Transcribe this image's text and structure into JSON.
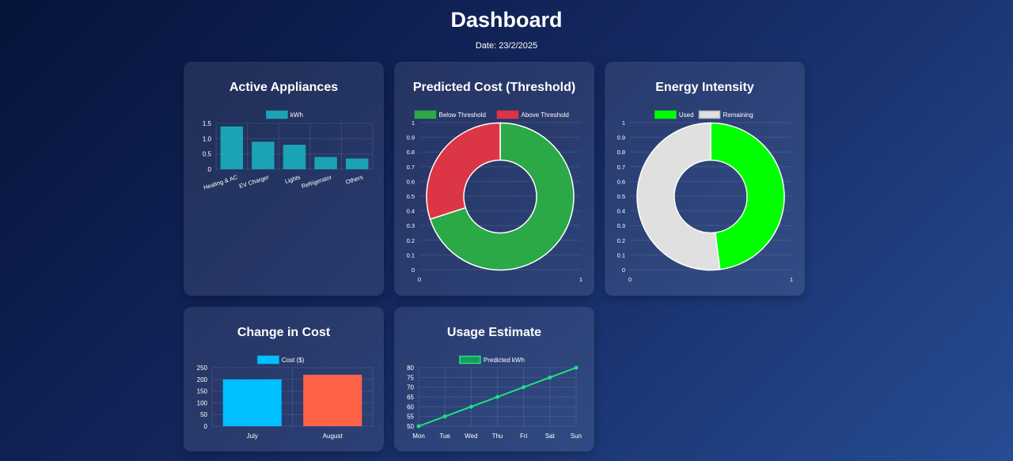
{
  "header": {
    "title": "Dashboard",
    "date": "Date: 23/2/2025"
  },
  "colors": {
    "appliances_bar": "#1aa3b5",
    "below_threshold": "#2aa946",
    "above_threshold": "#dc3545",
    "used": "#00ff00",
    "remaining": "#e0e0e0",
    "july": "#00bfff",
    "august": "#ff6347",
    "predicted_line": "#1ee37f"
  },
  "cards": {
    "appliances": {
      "title": "Active Appliances"
    },
    "cost_threshold": {
      "title": "Predicted Cost (Threshold)"
    },
    "energy_intensity": {
      "title": "Energy Intensity"
    },
    "change_cost": {
      "title": "Change in Cost"
    },
    "usage_estimate": {
      "title": "Usage Estimate"
    }
  },
  "chart_data": [
    {
      "id": "appliances",
      "type": "bar",
      "categories": [
        "Heating & AC",
        "EV Charger",
        "Lights",
        "Refrigerator",
        "Others"
      ],
      "series": [
        {
          "name": "kWh",
          "values": [
            1.4,
            0.9,
            0.8,
            0.4,
            0.35
          ]
        }
      ],
      "ylim": [
        0,
        1.5
      ],
      "yticks": [
        "1.5",
        "1.0",
        "0.5",
        "0"
      ],
      "legend": "top",
      "grid": true
    },
    {
      "id": "cost_threshold",
      "type": "pie",
      "labels": [
        "Below Threshold",
        "Above Threshold"
      ],
      "values": [
        70,
        30
      ],
      "yticks": [
        "1",
        "0.9",
        "0.8",
        "0.7",
        "0.6",
        "0.5",
        "0.4",
        "0.3",
        "0.2",
        "0.1",
        "0"
      ],
      "xticks": [
        "0",
        "1"
      ],
      "legend": "top",
      "grid": true
    },
    {
      "id": "energy_intensity",
      "type": "pie",
      "labels": [
        "Used",
        "Remaining"
      ],
      "values": [
        48,
        52
      ],
      "yticks": [
        "1",
        "0.9",
        "0.8",
        "0.7",
        "0.6",
        "0.5",
        "0.4",
        "0.3",
        "0.2",
        "0.1",
        "0"
      ],
      "xticks": [
        "0",
        "1"
      ],
      "legend": "top",
      "grid": true
    },
    {
      "id": "change_cost",
      "type": "bar",
      "categories": [
        "July",
        "August"
      ],
      "series": [
        {
          "name": "Cost ($)",
          "values": [
            200,
            220
          ]
        }
      ],
      "ylim": [
        0,
        250
      ],
      "yticks": [
        "250",
        "200",
        "150",
        "100",
        "50",
        "0"
      ],
      "legend": "top",
      "grid": true
    },
    {
      "id": "usage_estimate",
      "type": "line",
      "categories": [
        "Mon",
        "Tue",
        "Wed",
        "Thu",
        "Fri",
        "Sat",
        "Sun"
      ],
      "series": [
        {
          "name": "Predicted kWh",
          "values": [
            50,
            55,
            60,
            65,
            70,
            75,
            80
          ]
        }
      ],
      "ylim": [
        50,
        80
      ],
      "yticks": [
        "80",
        "75",
        "70",
        "65",
        "60",
        "55",
        "50"
      ],
      "legend": "top",
      "grid": true
    }
  ]
}
